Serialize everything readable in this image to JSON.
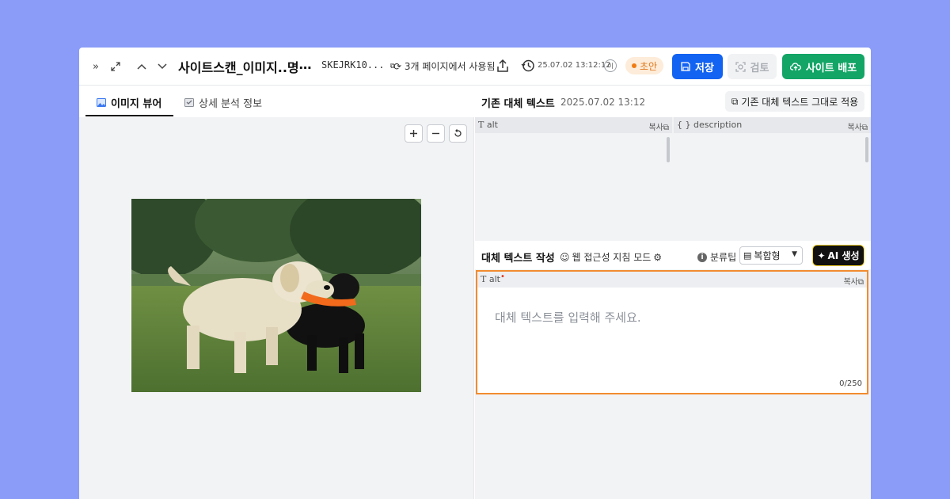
{
  "header": {
    "title": "사이트스캔_이미지..명⋯",
    "doc_id": "SKEJRK10...",
    "usage": "3개 페이지에서 사용됨",
    "timestamp": "25.07.02 13:12:12",
    "user_badge": "이",
    "status": "초안",
    "save_label": "저장",
    "review_label": "검토",
    "deploy_label": "사이트 배포"
  },
  "left_panel": {
    "tabs": [
      {
        "label": "이미지 뷰어",
        "active": true
      },
      {
        "label": "상세 분석 정보",
        "active": false
      }
    ],
    "image_subject": "two labrador retrievers, yellow and black, carrying an orange toy on grass"
  },
  "right_panel": {
    "existing": {
      "title": "기존 대체 텍스트",
      "date": "2025.07.02 13:12",
      "apply_label": "기존 대체 텍스트 그대로 적용",
      "alt_label": "alt",
      "description_label": "description",
      "copy_label": "복사"
    },
    "compose": {
      "title": "대체 텍스트 작성",
      "a11y_mode": "웹 접근성 지침 모드",
      "tip_label": "분류팁",
      "classification": "복합형",
      "ai_label": "AI 생성",
      "field_label": "alt",
      "copy_label": "복사",
      "placeholder": "대체 텍스트를 입력해 주세요.",
      "counter": "0/250"
    }
  },
  "colors": {
    "background": "#8a9cf8",
    "primary": "#1363f2",
    "deploy": "#12a566",
    "draft": "#f07b12",
    "focus_border": "#f28b30"
  }
}
